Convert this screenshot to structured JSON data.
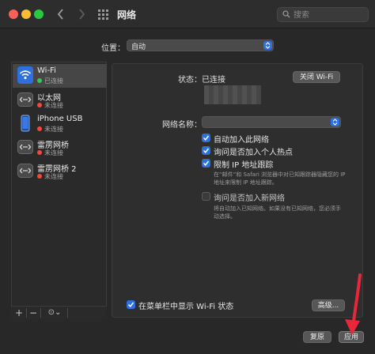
{
  "window": {
    "title": "网络",
    "search_placeholder": "搜索"
  },
  "location": {
    "label": "位置：",
    "value": "自动"
  },
  "sidebar": {
    "items": [
      {
        "name": "Wi-Fi",
        "status": "已连接",
        "status_color": "#34c759",
        "icon": "wifi-icon",
        "selected": true
      },
      {
        "name": "以太网",
        "status": "未连接",
        "status_color": "#ff453a",
        "icon": "ethernet-icon",
        "selected": false
      },
      {
        "name": "iPhone USB",
        "status": "未连接",
        "status_color": "#ff453a",
        "icon": "iphone-icon",
        "selected": false
      },
      {
        "name": "雷雳网桥",
        "status": "未连接",
        "status_color": "#ff453a",
        "icon": "thunderbolt-bridge-icon",
        "selected": false
      },
      {
        "name": "雷雳网桥 2",
        "status": "未连接",
        "status_color": "#ff453a",
        "icon": "thunderbolt-bridge-icon",
        "selected": false
      }
    ],
    "add_label": "+",
    "remove_label": "−",
    "more_label": "⊙⌄"
  },
  "detail": {
    "status_label": "状态：",
    "status_value": "已连接",
    "wifi_off_button": "关闭 Wi-Fi",
    "network_name_label": "网络名称：",
    "network_name_value": "",
    "options": [
      {
        "label": "自动加入此网络",
        "checked": true
      },
      {
        "label": "询问是否加入个人热点",
        "checked": true
      },
      {
        "label": "限制 IP 地址跟踪",
        "checked": true
      }
    ],
    "ip_tracking_note_line1": "在“邮件”和 Safari 浏览器中对已知跟踪器隐藏您的 IP",
    "ip_tracking_note_line2": "地址来限制 IP 地址跟踪。",
    "ask_new_label": "询问是否加入新网络",
    "ask_new_checked": false,
    "ask_new_note_line1": "将自动加入已知网络。如果没有已知网络，您必须手",
    "ask_new_note_line2": "动选择。",
    "menubar_label": "在菜单栏中显示 Wi-Fi 状态",
    "menubar_checked": true,
    "advanced_button": "高级..."
  },
  "footer": {
    "revert_button": "复原",
    "apply_button": "应用"
  },
  "colors": {
    "accent": "#2f6fe0",
    "annotation_arrow": "#e8283a"
  }
}
